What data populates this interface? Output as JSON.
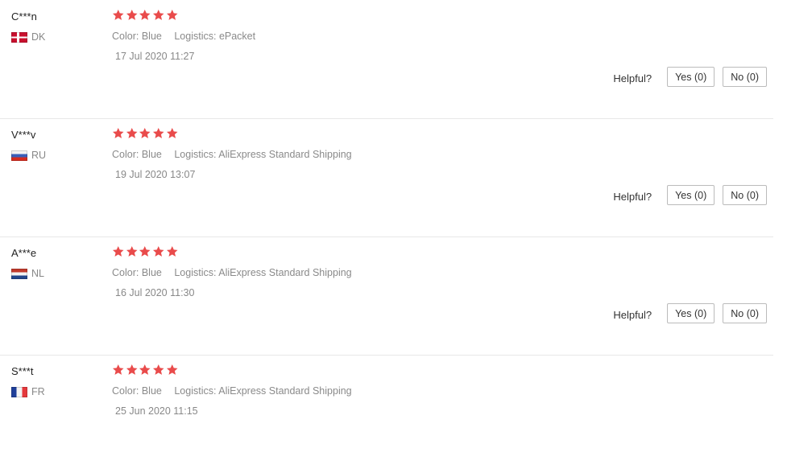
{
  "colors": {
    "star": "#e94b4b"
  },
  "reviews": [
    {
      "user": "C***n",
      "country": "DK",
      "flag_icon": "flag-dk-icon",
      "rating": 5,
      "color_label": "Color:",
      "color_value": "Blue",
      "logistics_label": "Logistics:",
      "logistics_value": "ePacket",
      "date": "17 Jul 2020 11:27",
      "helpful_label": "Helpful?",
      "yes_label": "Yes (0)",
      "no_label": "No (0)"
    },
    {
      "user": "V***v",
      "country": "RU",
      "flag_icon": "flag-ru-icon",
      "rating": 5,
      "color_label": "Color:",
      "color_value": "Blue",
      "logistics_label": "Logistics:",
      "logistics_value": "AliExpress Standard Shipping",
      "date": "19 Jul 2020 13:07",
      "helpful_label": "Helpful?",
      "yes_label": "Yes (0)",
      "no_label": "No (0)"
    },
    {
      "user": "A***e",
      "country": "NL",
      "flag_icon": "flag-nl-icon",
      "rating": 5,
      "color_label": "Color:",
      "color_value": "Blue",
      "logistics_label": "Logistics:",
      "logistics_value": "AliExpress Standard Shipping",
      "date": "16 Jul 2020 11:30",
      "helpful_label": "Helpful?",
      "yes_label": "Yes (0)",
      "no_label": "No (0)"
    },
    {
      "user": "S***t",
      "country": "FR",
      "flag_icon": "flag-fr-icon",
      "rating": 5,
      "color_label": "Color:",
      "color_value": "Blue",
      "logistics_label": "Logistics:",
      "logistics_value": "AliExpress Standard Shipping",
      "date": "25 Jun 2020 11:15"
    }
  ]
}
